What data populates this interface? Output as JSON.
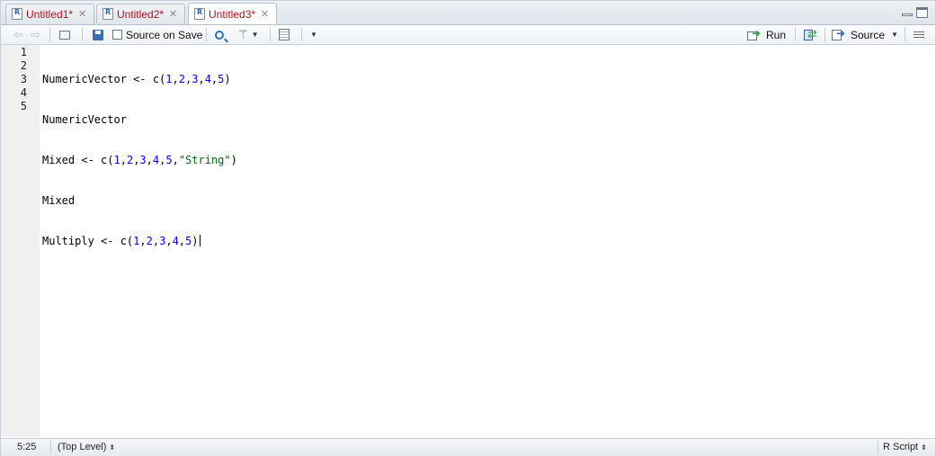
{
  "tabs": [
    {
      "label": "Untitled1*",
      "active": false
    },
    {
      "label": "Untitled2*",
      "active": false
    },
    {
      "label": "Untitled3*",
      "active": true
    }
  ],
  "toolbar": {
    "source_on_save_label": "Source on Save",
    "source_on_save_checked": false,
    "run_label": "Run",
    "source_label": "Source"
  },
  "editor": {
    "line_numbers": [
      "1",
      "2",
      "3",
      "4",
      "5"
    ],
    "lines": [
      "NumericVector <- c(1,2,3,4,5)",
      "NumericVector",
      "Mixed <- c(1,2,3,4,5,\"String\")",
      "Mixed",
      "Multiply <- c(1,2,3,4,5)"
    ]
  },
  "status": {
    "position": "5:25",
    "scope": "(Top Level)",
    "file_type": "R Script"
  },
  "colors": {
    "tab_label": "#b5121b",
    "number": "#0000ff",
    "string": "#036a07",
    "run_arrow": "#21a34a"
  }
}
